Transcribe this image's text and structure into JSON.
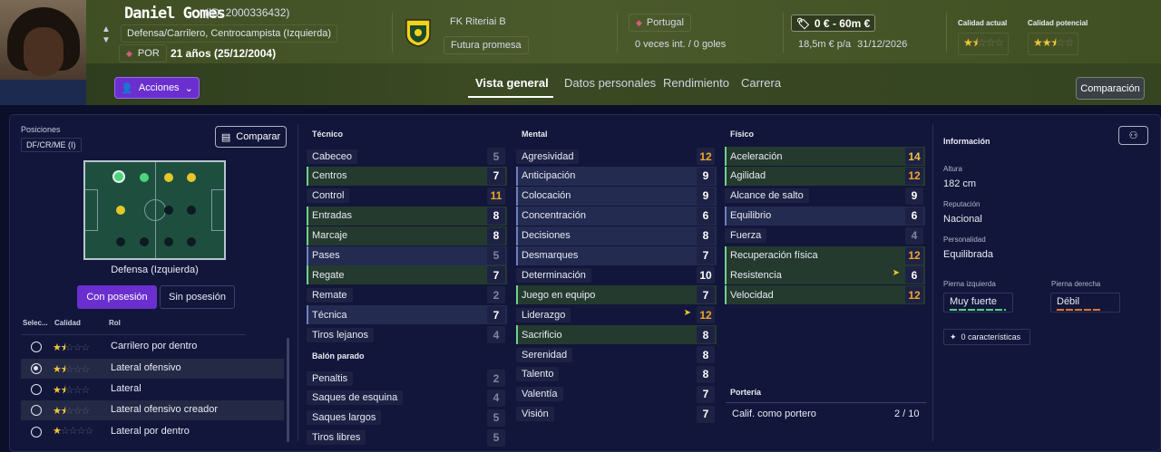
{
  "player": {
    "name": "Daniel Gomes",
    "id": "(ID: 2000336432)",
    "positions": "Defensa/Carrilero, Centrocampista (Izquierda)",
    "nationality_code": "POR",
    "age": "21 años (25/12/2004)",
    "actions_label": "Acciones"
  },
  "club": {
    "name": "FK Riteriai B",
    "status": "Futura promesa"
  },
  "country": {
    "name": "Portugal",
    "caps": "0 veces int. / 0 goles"
  },
  "value": {
    "range": "0 € - 60m €",
    "wage": "18,5m € p/a",
    "contract_end": "31/12/2026"
  },
  "quality": {
    "current_label": "Calidad actual",
    "current_stars": 1.5,
    "potential_label": "Calidad potencial",
    "potential_stars": 2.5
  },
  "tabs": [
    "Vista general",
    "Datos personales",
    "Rendimiento",
    "Carrera"
  ],
  "active_tab": "Vista general",
  "compare_button": "Comparación",
  "positions_panel": {
    "label": "Posiciones",
    "chip": "DF/CR/ME (I)",
    "compare": "Comparar",
    "role_name": "Defensa (Izquierda)",
    "toggle_on": "Con posesión",
    "toggle_off": "Sin posesión",
    "headers": [
      "Selec...",
      "Calidad",
      "Rol"
    ],
    "roles": [
      {
        "label": "Carrilero por dentro",
        "stars": 1.5,
        "selected": false
      },
      {
        "label": "Lateral ofensivo",
        "stars": 1.5,
        "selected": true
      },
      {
        "label": "Lateral",
        "stars": 1.5,
        "selected": false
      },
      {
        "label": "Lateral ofensivo creador",
        "stars": 1.5,
        "selected": false
      },
      {
        "label": "Lateral por dentro",
        "stars": 1,
        "selected": false
      }
    ]
  },
  "attributes": {
    "tecnico": {
      "title": "Técnico",
      "items": [
        [
          "Cabeceo",
          "5",
          "d",
          ""
        ],
        [
          "Centros",
          "7",
          "w",
          "g"
        ],
        [
          "Control",
          "11",
          "o",
          ""
        ],
        [
          "Entradas",
          "8",
          "w",
          "g"
        ],
        [
          "Marcaje",
          "8",
          "w",
          "g"
        ],
        [
          "Pases",
          "5",
          "d",
          "b"
        ],
        [
          "Regate",
          "7",
          "w",
          "g"
        ],
        [
          "Remate",
          "2",
          "d",
          ""
        ],
        [
          "Técnica",
          "7",
          "w",
          "b"
        ],
        [
          "Tiros lejanos",
          "4",
          "d",
          ""
        ]
      ]
    },
    "balon_parado": {
      "title": "Balón parado",
      "items": [
        [
          "Penaltis",
          "2",
          "d",
          ""
        ],
        [
          "Saques de esquina",
          "4",
          "d",
          ""
        ],
        [
          "Saques largos",
          "5",
          "d",
          ""
        ],
        [
          "Tiros libres",
          "5",
          "d",
          ""
        ]
      ]
    },
    "mental": {
      "title": "Mental",
      "items": [
        [
          "Agresividad",
          "12",
          "o",
          ""
        ],
        [
          "Anticipación",
          "9",
          "w",
          "b"
        ],
        [
          "Colocación",
          "9",
          "w",
          "b"
        ],
        [
          "Concentración",
          "6",
          "w",
          "b"
        ],
        [
          "Decisiones",
          "8",
          "w",
          "b"
        ],
        [
          "Desmarques",
          "7",
          "w",
          "b"
        ],
        [
          "Determinación",
          "10",
          "w",
          ""
        ],
        [
          "Juego en equipo",
          "7",
          "w",
          "g"
        ],
        [
          "Liderazgo",
          "12",
          "o",
          ""
        ],
        [
          "Sacrificio",
          "8",
          "w",
          "g"
        ],
        [
          "Serenidad",
          "8",
          "w",
          ""
        ],
        [
          "Talento",
          "8",
          "w",
          ""
        ],
        [
          "Valentía",
          "7",
          "w",
          ""
        ],
        [
          "Visión",
          "7",
          "w",
          ""
        ]
      ]
    },
    "fisico": {
      "title": "Físico",
      "items": [
        [
          "Aceleración",
          "14",
          "y",
          "g"
        ],
        [
          "Agilidad",
          "12",
          "o",
          "g"
        ],
        [
          "Alcance de salto",
          "9",
          "w",
          ""
        ],
        [
          "Equilibrio",
          "6",
          "w",
          "b"
        ],
        [
          "Fuerza",
          "4",
          "d",
          ""
        ],
        [
          "Recuperación física",
          "12",
          "o",
          "g"
        ],
        [
          "Resistencia",
          "6",
          "w",
          "g"
        ],
        [
          "Velocidad",
          "12",
          "o",
          "g"
        ]
      ]
    },
    "porteria": {
      "title": "Portería",
      "label": "Calif. como portero",
      "value": "2 / 10"
    }
  },
  "info": {
    "title": "Información",
    "altura_k": "Altura",
    "altura_v": "182 cm",
    "rep_k": "Reputación",
    "rep_v": "Nacional",
    "pers_k": "Personalidad",
    "pers_v": "Equilibrada",
    "left_k": "Pierna izquierda",
    "left_v": "Muy fuerte",
    "right_k": "Pierna derecha",
    "right_v": "Débil",
    "traits": "0 características"
  },
  "colors": {
    "accent": "#6b2fd0",
    "good": "#4bd67d",
    "warn": "#f1a62a",
    "gold": "#f0c33a"
  }
}
